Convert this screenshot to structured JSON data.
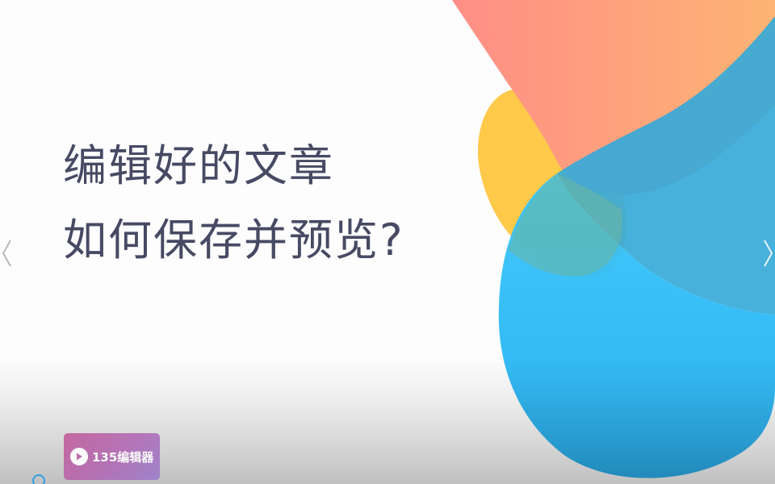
{
  "slide": {
    "title_line1": "编辑好的文章",
    "title_line2": "如何保存并预览?",
    "title_color": "#474a63"
  },
  "navigation": {
    "prev_icon": "chevron-left-icon",
    "next_icon": "chevron-right-icon"
  },
  "watermark": {
    "icon": "play-icon",
    "label": "135编辑器",
    "color": "#b865ad"
  },
  "decoration": {
    "blob_colors": {
      "salmon": "#ff9484",
      "orange": "#fdb076",
      "yellow": "#ffc94a",
      "blue": "#2db9ee",
      "light_blue": "#35c4f9"
    }
  }
}
